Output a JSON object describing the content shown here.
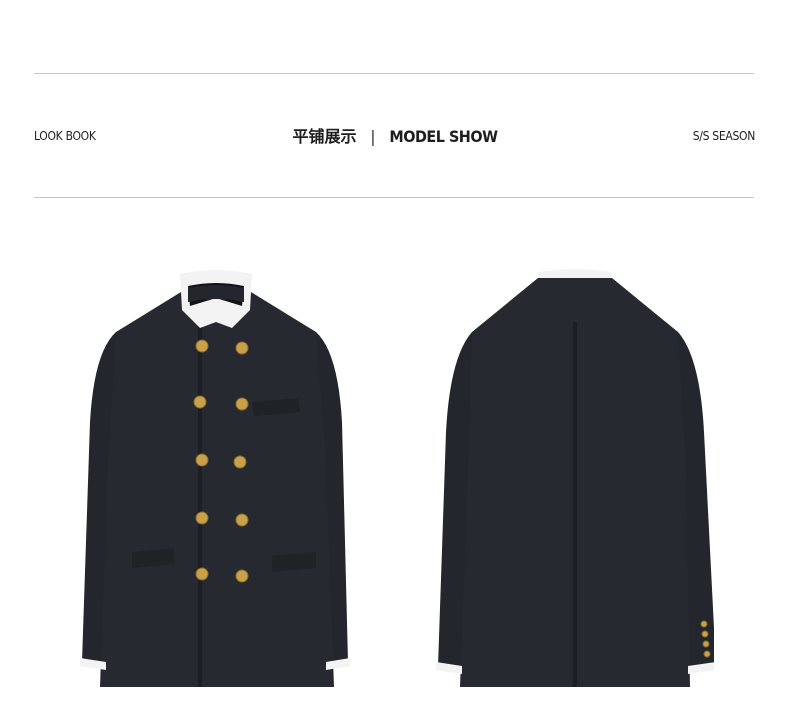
{
  "header": {
    "left_label": "LOOK BOOK",
    "center_cn": "平铺展示",
    "center_separator": "|",
    "center_en": "MODEL SHOW",
    "right_label": "S/S SEASON"
  },
  "images": {
    "front": "jacket-front",
    "back": "jacket-back"
  },
  "colors": {
    "fabric": "#262a30",
    "fabric_shadow": "#16191d",
    "collar_white": "#f3f3f3",
    "button_gold": "#c9a14a",
    "rule_line": "#c8c8c8",
    "text": "#222222"
  }
}
